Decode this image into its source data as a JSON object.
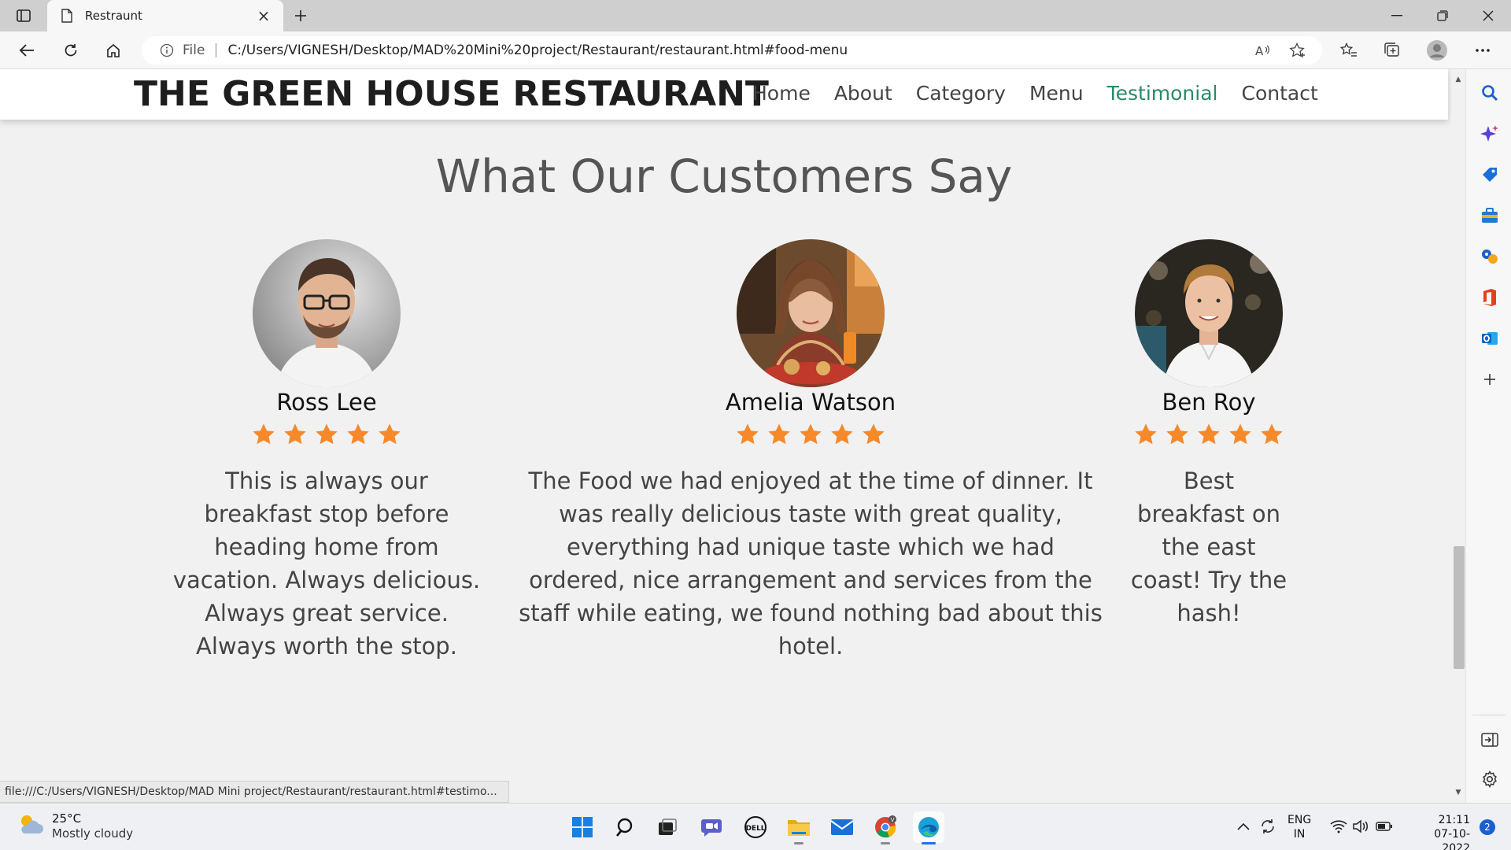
{
  "browser": {
    "tab_title": "Restraunt",
    "address_prefix": "File",
    "url": "C:/Users/VIGNESH/Desktop/MAD%20Mini%20project/Restaurant/restaurant.html#food-menu",
    "status_link": "file:///C:/Users/VIGNESH/Desktop/MAD Mini project/Restaurant/restaurant.html#testimo..."
  },
  "site": {
    "brand": "THE GREEN HOUSE RESTAURANT",
    "nav": [
      "Home",
      "About",
      "Category",
      "Menu",
      "Testimonial",
      "Contact"
    ],
    "active_nav": "Testimonial",
    "accent_color": "#2a8a6a",
    "star_color": "#f7892a"
  },
  "testimonials": {
    "title": "What Our Customers Say",
    "items": [
      {
        "name": "Ross Lee",
        "rating": 5,
        "review": "This is always our breakfast stop before heading home from vacation. Always delicious. Always great service. Always worth the stop."
      },
      {
        "name": "Amelia Watson",
        "rating": 5,
        "review": "The Food we had enjoyed at the time of dinner. It was really delicious taste with great quality, everything had unique taste which we had ordered, nice arrangement and services from the staff while eating, we found nothing bad about this hotel."
      },
      {
        "name": "Ben Roy",
        "rating": 5,
        "review": "Best breakfast on the east coast! Try the hash!"
      }
    ]
  },
  "taskbar": {
    "weather_temp": "25°C",
    "weather_cond": "Mostly cloudy",
    "lang_1": "ENG",
    "lang_2": "IN",
    "time": "21:11",
    "date": "07-10-2022",
    "notifications": "2"
  }
}
